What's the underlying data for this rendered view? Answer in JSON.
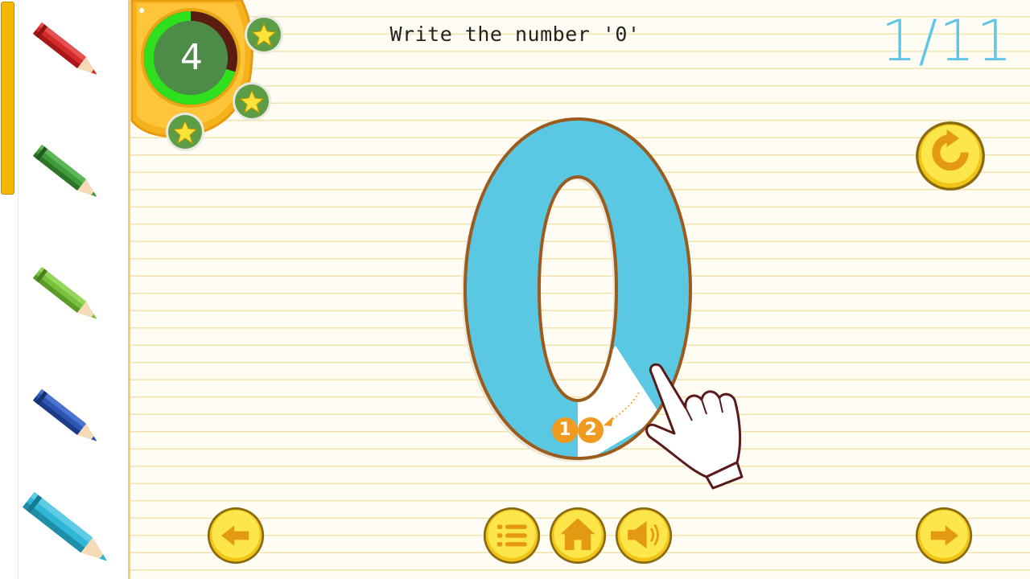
{
  "header": {
    "instruction": "Write the number '0'",
    "progress": "1/11"
  },
  "badge": {
    "score": "4",
    "stars_earned": 3,
    "ring_progress": 0.7
  },
  "digit": {
    "character": "0",
    "stroke_markers": [
      "1",
      "2"
    ]
  },
  "sidebar": {
    "pencils": [
      {
        "name": "red",
        "color": "#d42a2a"
      },
      {
        "name": "green",
        "color": "#3f9b3a"
      },
      {
        "name": "lime",
        "color": "#79c13d"
      },
      {
        "name": "blue",
        "color": "#2c55b4"
      },
      {
        "name": "cyan",
        "color": "#2eb7d6"
      }
    ],
    "selected": "cyan"
  },
  "buttons": {
    "replay": "replay-icon",
    "back": "arrow-left-icon",
    "menu": "list-icon",
    "home": "home-icon",
    "sound": "speaker-icon",
    "next": "arrow-right-icon"
  },
  "colors": {
    "digit_fill": "#5ac8e3",
    "digit_outline": "#9c5b1e",
    "counter": "#5ec6e6",
    "coin": "#f9d227",
    "marker": "#f09a1f"
  }
}
